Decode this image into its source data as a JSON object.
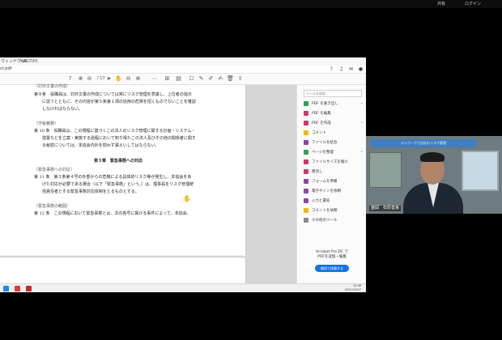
{
  "meeting_bar": {
    "right_items": [
      "共有",
      "ログイン"
    ]
  },
  "app_window": {
    "menu_items": [
      "ウィンドウ(W)",
      "ヘルプ(H)"
    ],
    "tab_label": "ct.pdf",
    "page_display": "/ 17"
  },
  "document": {
    "lines": [
      {
        "text": "（対外文書の作成）",
        "style": "s"
      },
      {
        "text": "第９条　役職員は、対外文書の作成については常にリスク管理を意識し、上位者の指示",
        "style": ""
      },
      {
        "text": "　　に従うとともに、その内容が第５条第１項の信用の危険を招くものでないことを確認",
        "style": ""
      },
      {
        "text": "　　しなければならない。",
        "style": ""
      },
      {
        "text": "（守秘義務）",
        "style": "s"
      },
      {
        "text": "第 10 条　役職員は、この規程に基づくこの法人のリスク管理に関する計画・システム・",
        "style": ""
      },
      {
        "text": "　　措置などを立案・実施する過程において知り得たこの法人及びその他の関係者に関す",
        "style": ""
      },
      {
        "text": "　　る秘密については、本協会内外を問わず漏えいしてはならない。",
        "style": ""
      },
      {
        "text": "第３章　緊急事態への対応",
        "style": "h"
      },
      {
        "text": "（緊急事態への対応）",
        "style": "s"
      },
      {
        "text": "第 11 条　第３条第４号の外部からの危機による具体的リスク等が発生し、本協会をあ",
        "style": ""
      },
      {
        "text": "　　げた対応が必要である場合（以下「緊急事態」という。）は、理事長をリスク管理統",
        "style": ""
      },
      {
        "text": "　　括責任者とする緊急事態対応体制をとるものとする。",
        "style": ""
      },
      {
        "text": "（緊急事態の範囲）",
        "style": "s"
      },
      {
        "text": "第 12 条　この規程において緊急事態とは、次の各号に掲げる事件によって、本協会、",
        "style": ""
      }
    ]
  },
  "tools_pane": {
    "search_placeholder": "ツールを検索",
    "items": [
      {
        "label": "PDF を書き出し",
        "color": "#2da44e"
      },
      {
        "label": "PDF を編集",
        "color": "#d6336c"
      },
      {
        "label": "PDF を作成",
        "color": "#d6336c"
      },
      {
        "label": "コメント",
        "color": "#f4b400"
      },
      {
        "label": "ファイルを結合",
        "color": "#8e44ad"
      },
      {
        "label": "ページを整理",
        "color": "#2da44e"
      },
      {
        "label": "ファイルサイズを縮小",
        "color": "#d6336c"
      },
      {
        "label": "墨消し",
        "color": "#d6336c"
      },
      {
        "label": "フォームを準備",
        "color": "#8e44ad"
      },
      {
        "label": "電子サインを依頼",
        "color": "#8e44ad"
      },
      {
        "label": "入力と署名",
        "color": "#8e44ad"
      },
      {
        "label": "コメントを依頼",
        "color": "#f4b400"
      },
      {
        "label": "その他のツール",
        "color": "#888888"
      }
    ],
    "promo_title": "Acrobat Pro DC で\nPDFを変換・編集",
    "promo_button": "無料で体験する"
  },
  "taskbar": {
    "time": "15:48",
    "date": "2022/10/27"
  },
  "webcam": {
    "banner": "テレワークで自社のリスク管理",
    "participant_name": "盛岡　石原善良"
  }
}
